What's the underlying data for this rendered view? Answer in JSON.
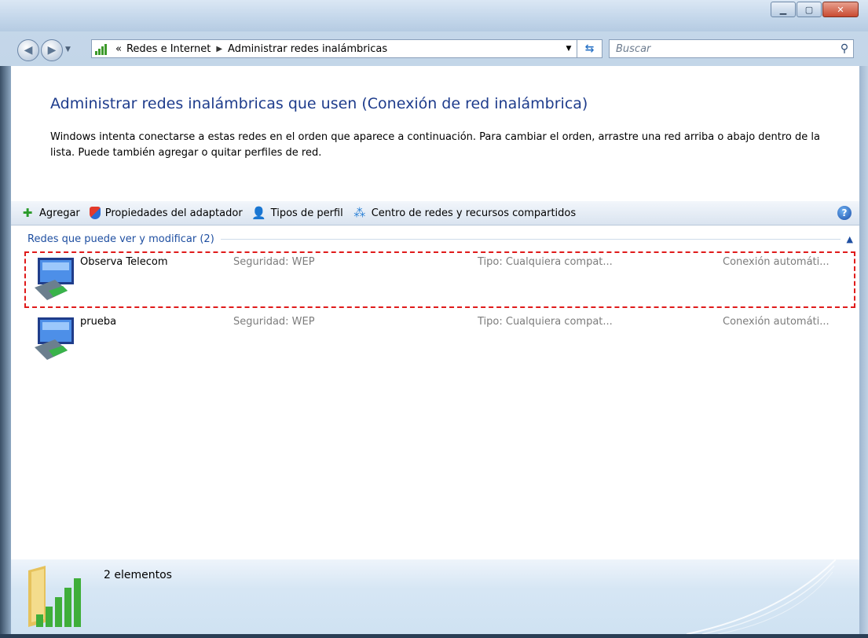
{
  "window": {
    "minimize_icon": "minimize-icon",
    "maximize_icon": "maximize-icon",
    "close_icon": "close-icon"
  },
  "navigation": {
    "breadcrumbs": [
      "Redes e Internet",
      "Administrar redes inalámbricas"
    ],
    "overflow_glyph": "«",
    "search_placeholder": "Buscar"
  },
  "main": {
    "title": "Administrar redes inalámbricas que usen (Conexión de red inalámbrica)",
    "description": "Windows intenta conectarse a estas redes en el orden que aparece a continuación. Para cambiar el orden, arrastre una red arriba o abajo dentro de la lista. Puede también agregar o quitar perfiles de red."
  },
  "toolbar": {
    "add": "Agregar",
    "adapter_properties": "Propiedades del adaptador",
    "profile_types": "Tipos de perfil",
    "network_center": "Centro de redes y recursos compartidos"
  },
  "group": {
    "header": "Redes que puede ver y modificar (2)"
  },
  "networks": [
    {
      "name": "Observa Telecom",
      "security": "Seguridad: WEP",
      "type": "Tipo: Cualquiera compat...",
      "connection": "Conexión automáti..."
    },
    {
      "name": "prueba",
      "security": "Seguridad: WEP",
      "type": "Tipo: Cualquiera compat...",
      "connection": "Conexión automáti..."
    }
  ],
  "status_bar": {
    "item_count": "2 elementos"
  },
  "colors": {
    "title_blue": "#1e3c8c",
    "group_blue": "#1f4fa1",
    "highlight_red": "#e01b1b"
  }
}
